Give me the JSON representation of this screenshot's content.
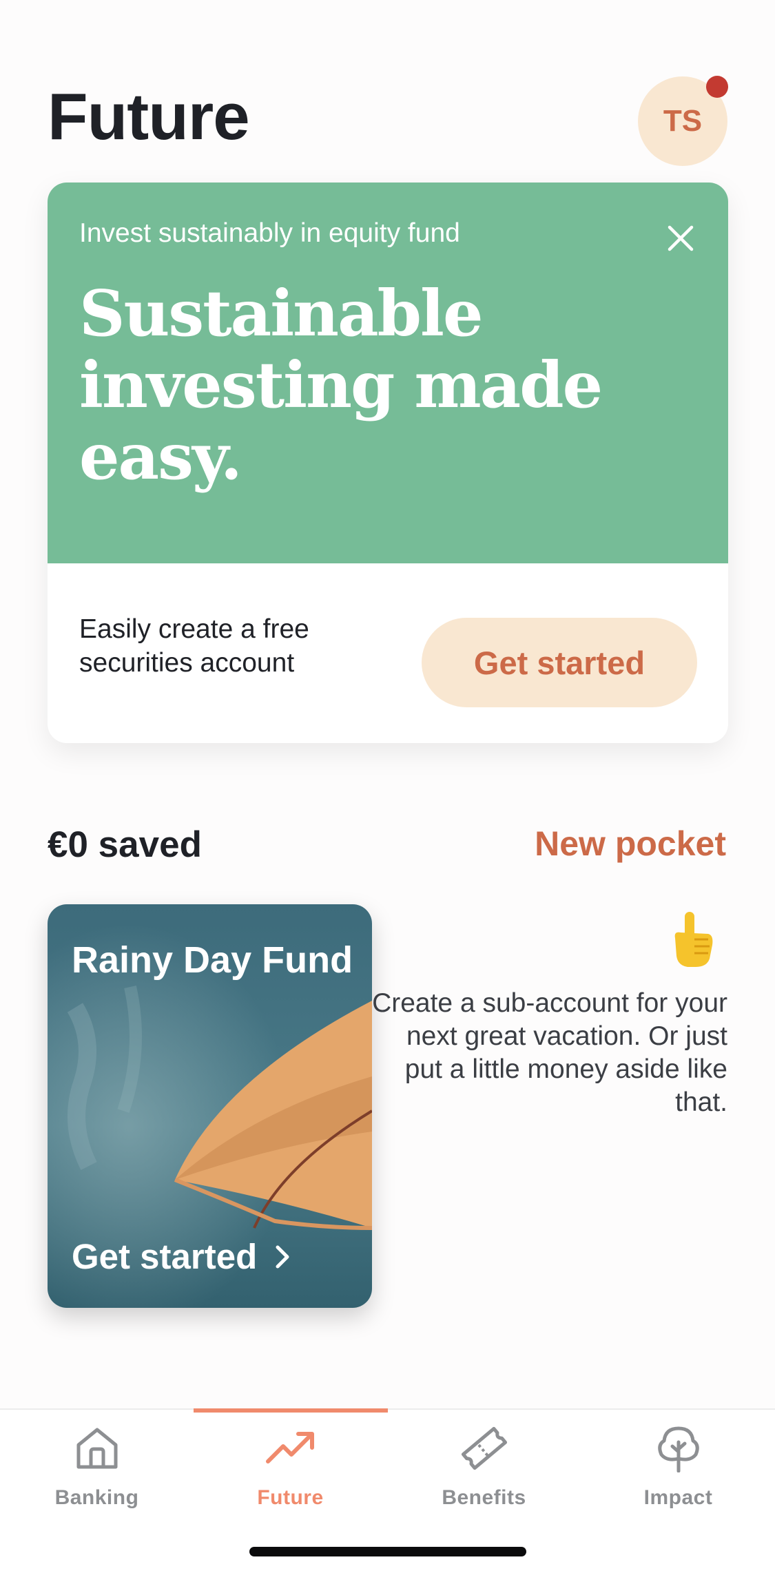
{
  "header": {
    "title": "Future",
    "avatar_initials": "TS",
    "notification_dot": true
  },
  "promo": {
    "eyebrow": "Invest sustainably in equity fund",
    "headline": "Sustainable investing made easy.",
    "subtitle": "Easily create a free securities account",
    "cta_label": "Get started",
    "close_icon": "close-icon"
  },
  "savings": {
    "total_label": "€0 saved",
    "new_pocket_label": "New pocket"
  },
  "pocket": {
    "title": "Rainy Day Fund",
    "cta_label": "Get started",
    "hint_emoji": "pointing-up-hand-icon",
    "hint_text": "Create a sub-account for your next great vacation. Or just put a little money aside like that."
  },
  "tabs": [
    {
      "label": "Banking",
      "icon": "home-icon",
      "active": false
    },
    {
      "label": "Future",
      "icon": "trending-up-icon",
      "active": true
    },
    {
      "label": "Benefits",
      "icon": "ticket-icon",
      "active": false
    },
    {
      "label": "Impact",
      "icon": "tree-icon",
      "active": false
    }
  ],
  "colors": {
    "accent": "#cc6a48",
    "accent_light": "#f9e7d1",
    "tab_active": "#f08a6c",
    "promo_green": "#76bc97",
    "pocket_teal": "#3f6c7a",
    "notification": "#c33a31"
  }
}
